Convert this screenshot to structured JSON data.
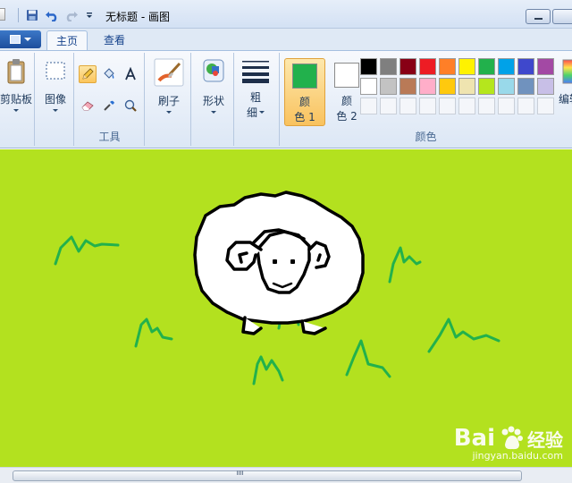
{
  "window": {
    "title": "无标题 - 画图"
  },
  "quick_access": {
    "icons": [
      "app-icon",
      "save-icon",
      "undo-icon",
      "redo-icon",
      "customize-dropdown-icon"
    ]
  },
  "tabs": [
    {
      "label": "主页",
      "active": true
    },
    {
      "label": "查看",
      "active": false
    }
  ],
  "ribbon": {
    "clipboard": {
      "label": "剪贴板"
    },
    "image": {
      "label": "图像"
    },
    "tools": {
      "label": "工具",
      "selected_tool": "pencil"
    },
    "brushes": {
      "label": "刷子"
    },
    "shapes": {
      "label": "形状"
    },
    "size": {
      "label_line1": "粗",
      "label_line2": "细"
    },
    "color1": {
      "label_line1": "颜",
      "label_line2": "色 1",
      "color": "#22b14c"
    },
    "color2": {
      "label_line1": "颜",
      "label_line2": "色 2",
      "color": "#ffffff"
    },
    "colors_group_label": "颜色",
    "edit_colors": {
      "label": "编辑"
    },
    "palette": [
      [
        "#000000",
        "#7f7f7f",
        "#880015",
        "#ed1c24",
        "#ff7f27",
        "#fff200",
        "#22b14c",
        "#00a2e8",
        "#3f48cc",
        "#a349a4"
      ],
      [
        "#ffffff",
        "#c3c3c3",
        "#b97a57",
        "#ffaec9",
        "#ffc90e",
        "#efe4b0",
        "#b5e61d",
        "#99d9ea",
        "#7092be",
        "#c8bfe7"
      ],
      [
        "",
        "",
        "",
        "",
        "",
        "",
        "",
        "",
        "",
        ""
      ]
    ]
  },
  "canvas": {
    "background": "#b3e11f",
    "drawing": "sheep-and-grass"
  },
  "watermark": {
    "brand_prefix": "Bai",
    "brand_suffix": "经验",
    "url": "jingyan.baidu.com"
  }
}
